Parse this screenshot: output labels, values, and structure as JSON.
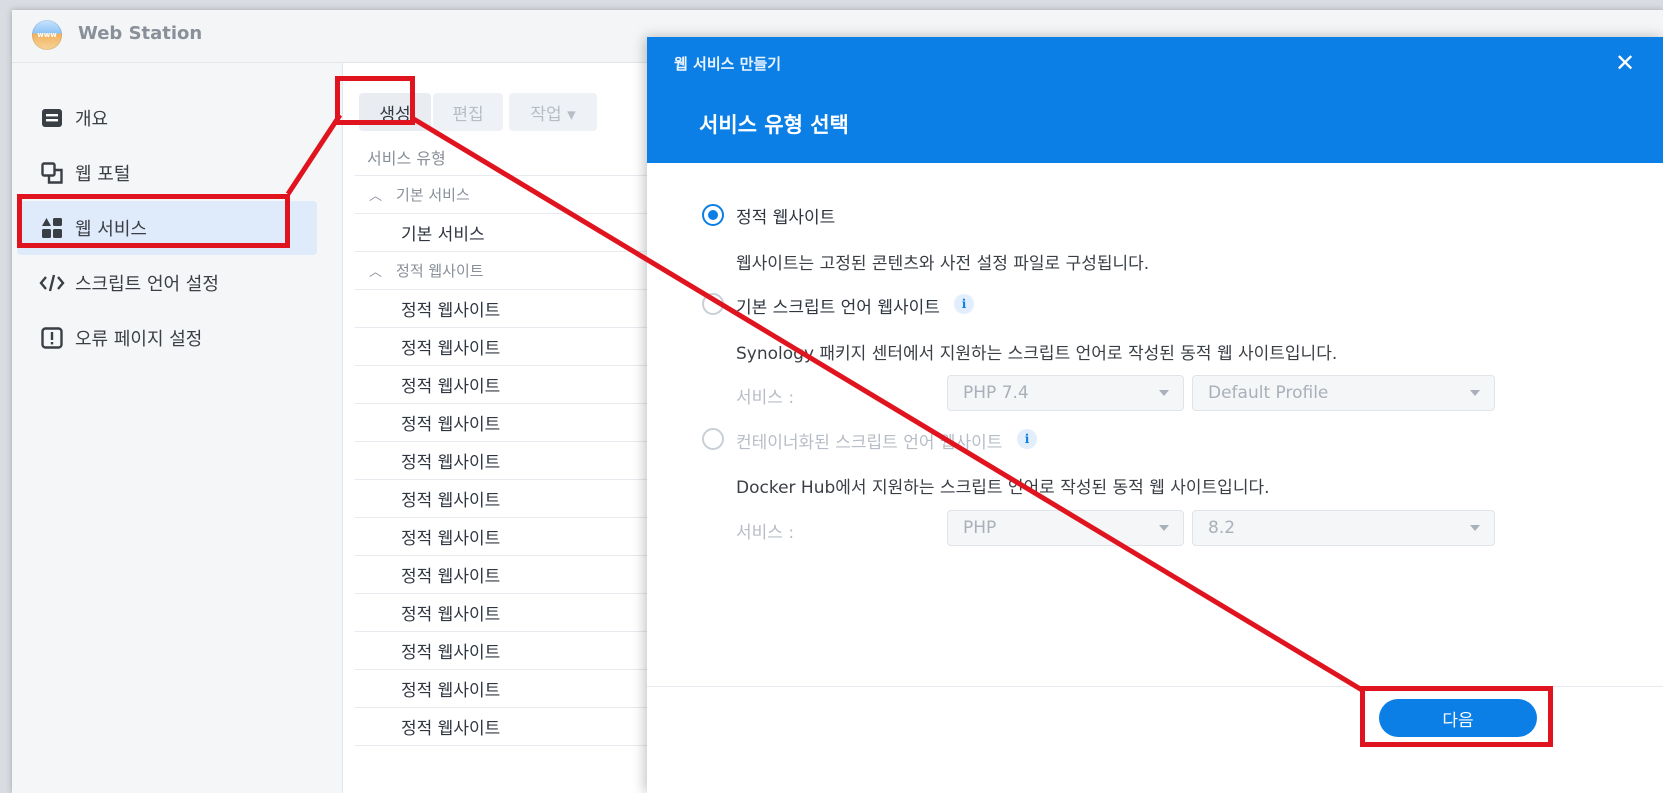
{
  "app": {
    "title": "Web Station",
    "logo_text": "www"
  },
  "sidebar": {
    "items": [
      {
        "label": "개요",
        "icon": "overview-icon"
      },
      {
        "label": "웹 포털",
        "icon": "web-portal-icon"
      },
      {
        "label": "웹 서비스",
        "icon": "web-service-icon",
        "active": true
      },
      {
        "label": "스크립트 언어 설정",
        "icon": "code-icon"
      },
      {
        "label": "오류 페이지 설정",
        "icon": "error-icon"
      }
    ]
  },
  "toolbar": {
    "create_label": "생성",
    "edit_label": "편집",
    "action_label": "작업 ▾"
  },
  "list": {
    "header": "서비스 유형",
    "groups": [
      {
        "label": "기본 서비스",
        "items": [
          "기본 서비스"
        ]
      },
      {
        "label": "정적 웹사이트",
        "items": [
          "정적 웹사이트",
          "정적 웹사이트",
          "정적 웹사이트",
          "정적 웹사이트",
          "정적 웹사이트",
          "정적 웹사이트",
          "정적 웹사이트",
          "정적 웹사이트",
          "정적 웹사이트",
          "정적 웹사이트",
          "정적 웹사이트",
          "정적 웹사이트"
        ]
      }
    ]
  },
  "dialog": {
    "small_title": "웹 서비스 만들기",
    "title": "서비스 유형 선택",
    "close": "✕",
    "options": [
      {
        "label": "정적 웹사이트",
        "selected": true,
        "enabled": true,
        "description": "웹사이트는 고정된 콘텐츠와 사전 설정 파일로 구성됩니다."
      },
      {
        "label": "기본 스크립트 언어 웹사이트",
        "selected": false,
        "enabled": true,
        "description": "Synology 패키지 센터에서 지원하는 스크립트 언어로 작성된 동적 웹 사이트입니다.",
        "service_label": "서비스 :",
        "select1": "PHP 7.4",
        "select2": "Default Profile"
      },
      {
        "label": "컨테이너화된 스크립트 언어 웹사이트",
        "selected": false,
        "enabled": false,
        "description": "Docker Hub에서 지원하는 스크립트 언어로 작성된 동적 웹 사이트입니다.",
        "service_label": "서비스 :",
        "select1": "PHP",
        "select2": "8.2"
      }
    ],
    "info_glyph": "i",
    "next_label": "다음"
  },
  "colors": {
    "accent": "#0b7fe6",
    "annotation": "#e0141e"
  }
}
